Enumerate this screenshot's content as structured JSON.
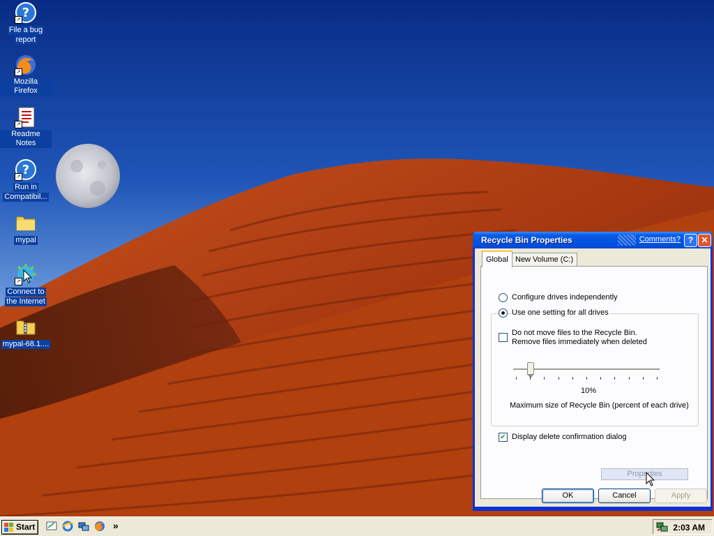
{
  "desktop": {
    "icons": [
      {
        "label_line1": "File a bug",
        "label_line2": "report",
        "icon": "help-icon"
      },
      {
        "label_line1": "Mozilla Firefox",
        "label_line2": "",
        "icon": "firefox-icon"
      },
      {
        "label_line1": "Readme Notes",
        "label_line2": "",
        "icon": "notes-icon"
      },
      {
        "label_line1": "Run in",
        "label_line2": "Compatibil...",
        "icon": "help-icon"
      },
      {
        "label_line1": "mypal",
        "label_line2": "",
        "icon": "folder-icon"
      },
      {
        "label_line1": "Connect to",
        "label_line2": "the Internet",
        "icon": "connect-icon"
      },
      {
        "label_line1": "mypal-68.1....",
        "label_line2": "",
        "icon": "zip-folder-icon"
      }
    ]
  },
  "dialog": {
    "title": "Recycle Bin Properties",
    "comments_link": "Comments?",
    "help_glyph": "?",
    "close_glyph": "✕",
    "tabs": [
      {
        "label": "Global",
        "active": true
      },
      {
        "label": "New Volume (C:)",
        "active": false
      }
    ],
    "radio_independent": "Configure drives independently",
    "radio_one_setting": "Use one setting for all drives",
    "no_move_line1": "Do not move files to the Recycle Bin.",
    "no_move_line2": "Remove files immediately when deleted",
    "slider_value": "10%",
    "slider_fraction": 0.1,
    "slider_caption": "Maximum size of Recycle Bin (percent of each drive)",
    "confirm_label": "Display delete confirmation dialog",
    "confirm_checked": true,
    "properties_label": "Properties",
    "ok_label": "OK",
    "cancel_label": "Cancel",
    "apply_label": "Apply"
  },
  "taskbar": {
    "start_label": "Start",
    "more_glyph": "»",
    "clock": "2:03 AM"
  },
  "colors": {
    "sky": "#1d4fb0",
    "dune": "#b53d12",
    "title_bar": "#0451e0"
  }
}
